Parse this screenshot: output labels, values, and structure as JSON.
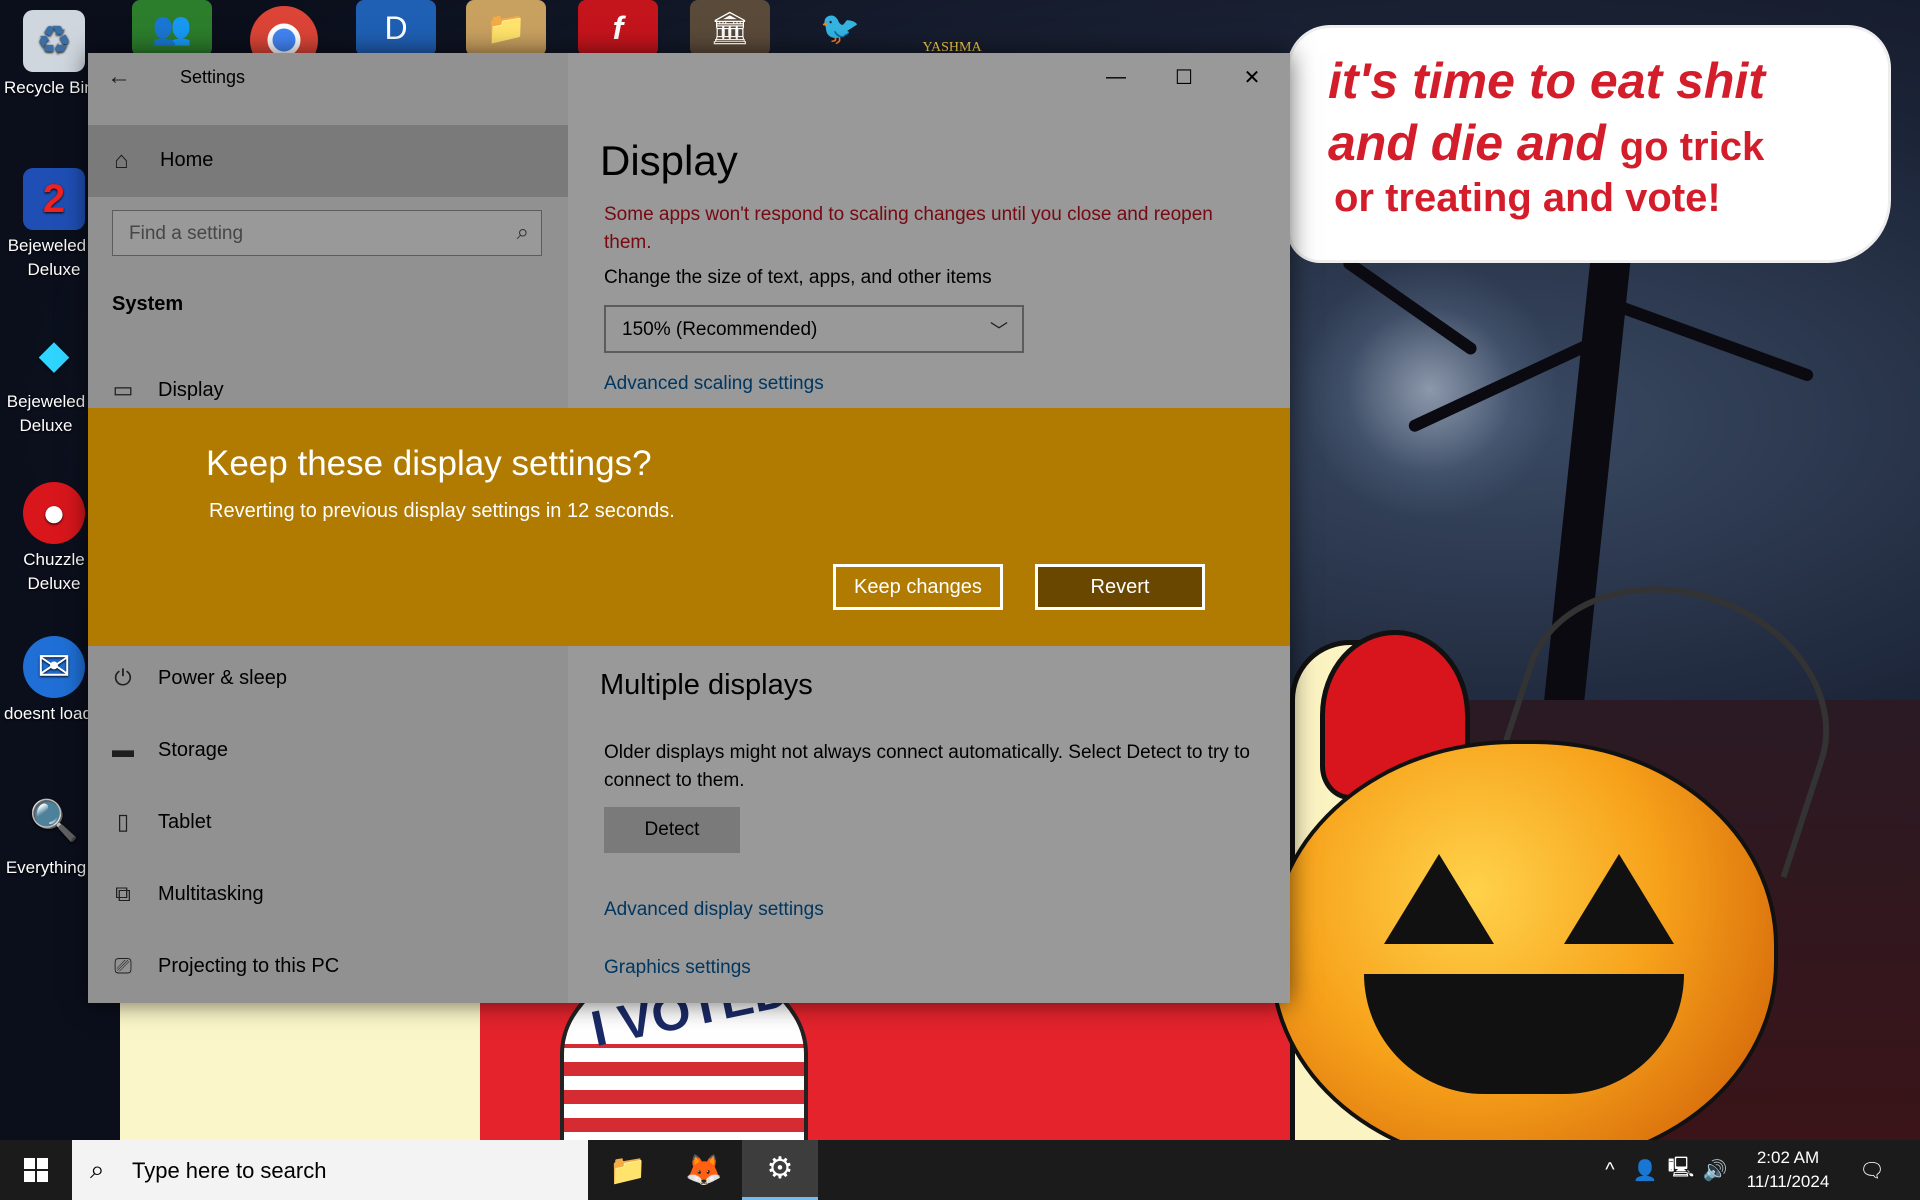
{
  "desktop": {
    "left_icons": [
      {
        "label": "Recycle Bin",
        "icon": "recycle-bin-icon"
      },
      {
        "label": "Bejeweled 2 Deluxe",
        "icon": "bejeweled2-icon"
      },
      {
        "label": "Bejeweled Deluxe",
        "icon": "bejeweled-icon"
      },
      {
        "label": "Chuzzle Deluxe",
        "icon": "chuzzle-icon"
      },
      {
        "label": "doesnt load",
        "icon": "thunderbird-icon"
      },
      {
        "label": "Everything",
        "icon": "everything-search-icon"
      }
    ],
    "top_icon_labels": {
      "yashma": "YASHMA"
    },
    "wallpaper_text": {
      "line1": "it's time to eat shit",
      "line2": "and die and",
      "line2b": "go trick",
      "line3": "or treating and vote!",
      "voted_sticker": "I VOTED"
    }
  },
  "window": {
    "title": "Settings",
    "sidebar": {
      "home": "Home",
      "search_placeholder": "Find a setting",
      "section": "System",
      "items": [
        {
          "label": "Display",
          "icon": "monitor-icon"
        },
        {
          "label": "Power & sleep",
          "icon": "power-icon"
        },
        {
          "label": "Storage",
          "icon": "storage-icon"
        },
        {
          "label": "Tablet",
          "icon": "tablet-icon"
        },
        {
          "label": "Multitasking",
          "icon": "multitasking-icon"
        },
        {
          "label": "Projecting to this PC",
          "icon": "projecting-icon"
        }
      ]
    },
    "main": {
      "heading": "Display",
      "warning": "Some apps won't respond to scaling changes until you close and reopen them.",
      "scale_label": "Change the size of text, apps, and other items",
      "scale_value": "150% (Recommended)",
      "advanced_scaling_link": "Advanced scaling settings",
      "multiple_heading": "Multiple displays",
      "multiple_body": "Older displays might not always connect automatically. Select Detect to try to connect to them.",
      "detect_button": "Detect",
      "advanced_display_link": "Advanced display settings",
      "graphics_link": "Graphics settings"
    }
  },
  "dialog": {
    "title": "Keep these display settings?",
    "message": "Reverting to previous display settings in 12 seconds.",
    "keep_button": "Keep changes",
    "revert_button": "Revert",
    "accent_color": "#b17a00"
  },
  "taskbar": {
    "search_placeholder": "Type here to search",
    "apps": [
      "file-explorer-icon",
      "firefox-icon",
      "settings-gear-icon"
    ],
    "time": "2:02 AM",
    "date": "11/11/2024"
  }
}
